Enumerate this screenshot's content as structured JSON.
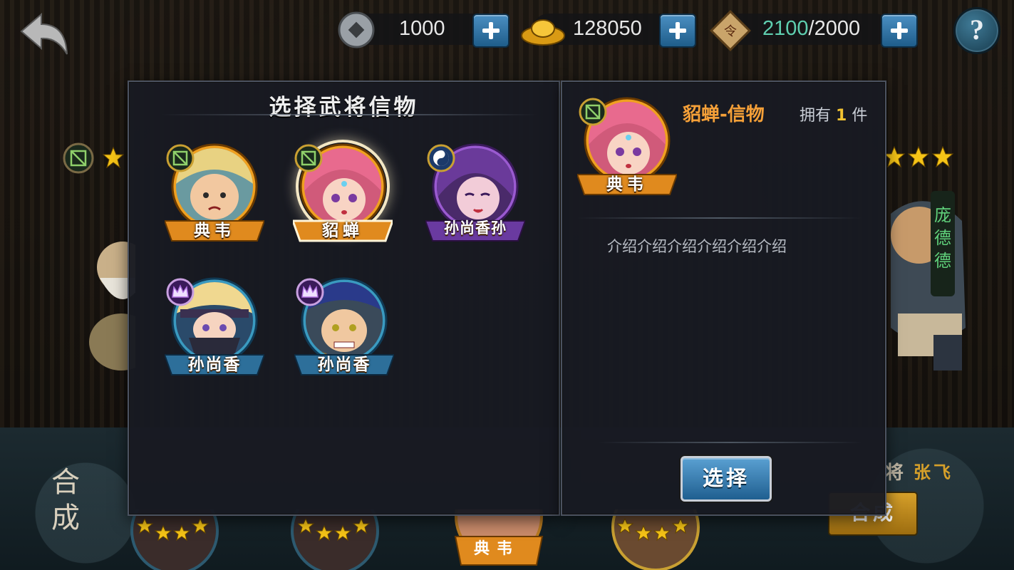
{
  "topbar": {
    "coins": "1000",
    "gold": "128050",
    "stamina_current": "2100",
    "stamina_max": "/2000",
    "help": "?"
  },
  "picker": {
    "title": "选择武将信物",
    "cards": [
      {
        "name": "典韦",
        "badge": "bow-badge-icon"
      },
      {
        "name": "貂蝉",
        "badge": "bow-badge-icon"
      },
      {
        "name": "孙尚香孙",
        "badge": "yin-yang-badge-icon"
      },
      {
        "name": "孙尚香",
        "badge": "crown-badge-icon"
      },
      {
        "name": "孙尚香",
        "badge": "crown-badge-icon"
      }
    ]
  },
  "detail": {
    "portrait_name": "典韦",
    "item_name": "貂蝉-信物",
    "own_prefix": "拥有",
    "own_count": "1",
    "own_suffix": "件",
    "description": "介绍介绍介绍介绍介绍介绍",
    "select_label": "选择"
  },
  "background": {
    "merge_label_top": "合",
    "merge_label_bottom": "成",
    "vertical_name": "庞德德",
    "bottom_card_name": "典韦",
    "general_label": "将",
    "general_name": "张飞",
    "merge_button": "合成"
  },
  "colors": {
    "gold_ribbon": "#e08a1e",
    "blue_ribbon": "#2d6f9a",
    "accent_orange": "#f5a038",
    "button_blue": "#3b84b8"
  }
}
